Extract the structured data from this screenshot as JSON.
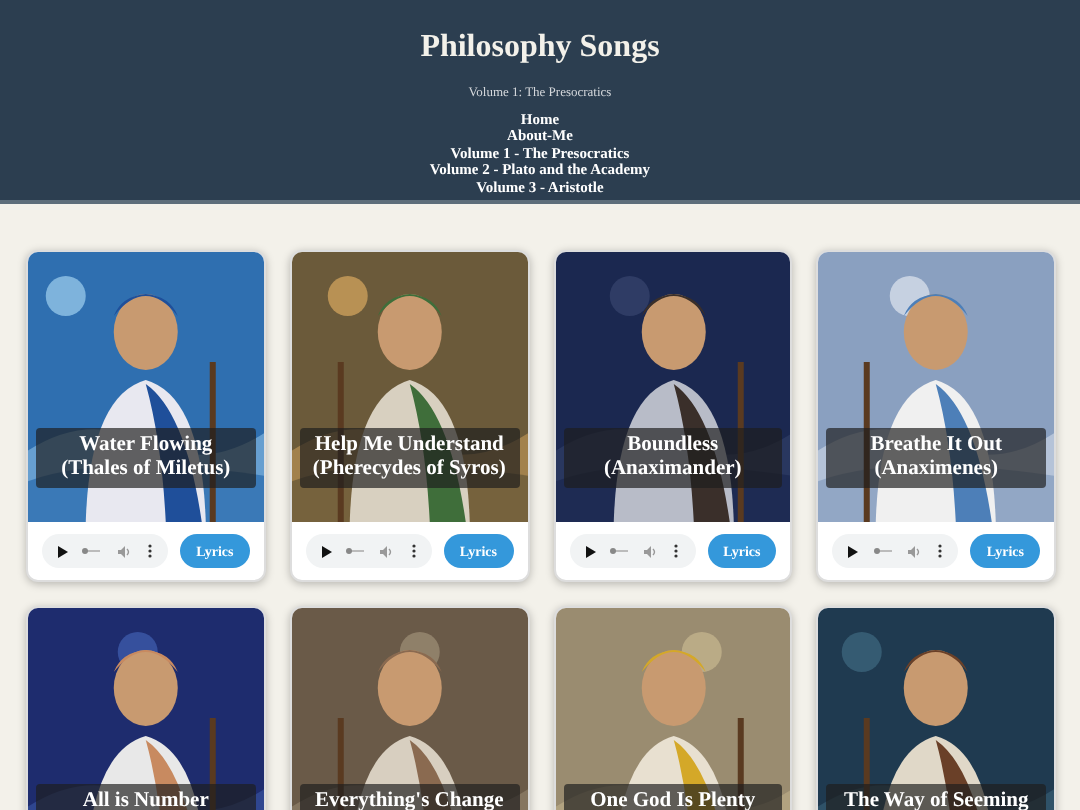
{
  "header": {
    "title": "Philosophy Songs",
    "subtitle": "Volume 1: The Presocratics",
    "nav": [
      "Home",
      "About-Me",
      "Volume 1 - The Presocratics",
      "Volume 2 - Plato and the Academy",
      "Volume 3 - Aristotle"
    ]
  },
  "songs": [
    {
      "title": "Water Flowing (Thales of Miletus)",
      "progress": {
        "level": 0
      },
      "lyrics_button": "Lyrics"
    },
    {
      "title": "Help Me Understand (Pherecydes of Syros)",
      "progress": {
        "level": 0
      },
      "lyrics_button": "Lyrics"
    },
    {
      "title": "Boundless (Anaximander)",
      "progress": {
        "level": 0
      },
      "lyrics_button": "Lyrics"
    },
    {
      "title": "Breathe It Out (Anaximenes)",
      "progress": {
        "level": 0
      },
      "lyrics_button": "Lyrics"
    },
    {
      "title": "All is Number"
    },
    {
      "title": "Everything's Change"
    },
    {
      "title": "One God Is Plenty"
    },
    {
      "title": "The Way of Seeming"
    }
  ]
}
